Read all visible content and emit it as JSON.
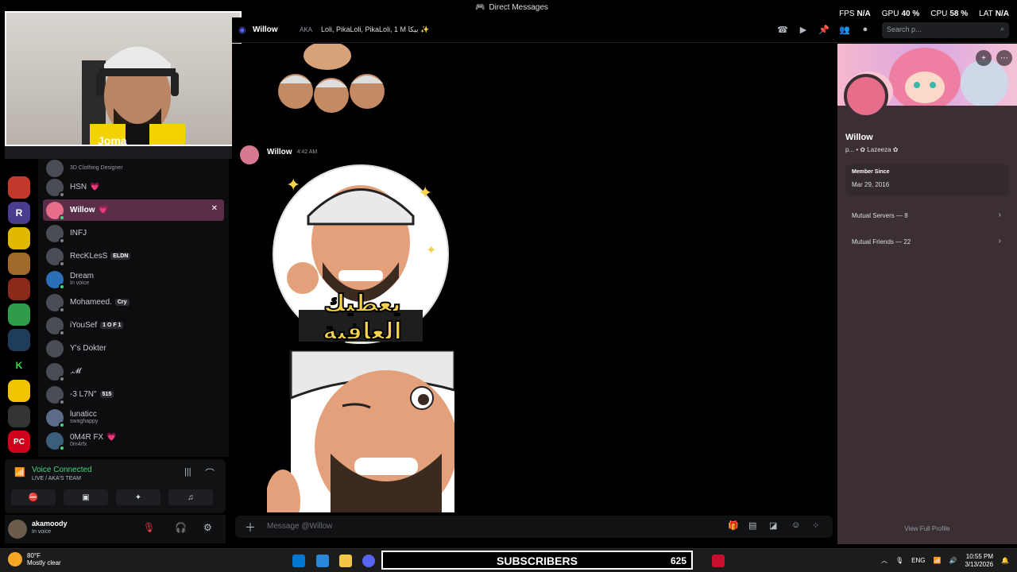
{
  "window": {
    "title": "Direct Messages"
  },
  "overlay": {
    "fps_label": "FPS",
    "fps": "N/A",
    "gpu_label": "GPU",
    "gpu": "40 %",
    "cpu_label": "CPU",
    "cpu": "58 %",
    "lat_label": "LAT",
    "lat": "N/A"
  },
  "webcam": {
    "shirt_text": "Joma"
  },
  "dm_list": [
    {
      "name": "HSN",
      "sub": "",
      "badge": "💗"
    },
    {
      "name": "Willow",
      "sub": "",
      "badge": "💗"
    },
    {
      "name": "INFJ",
      "sub": "",
      "badge": ""
    },
    {
      "name": "RecKLesS",
      "sub": "",
      "badge": "ELDN"
    },
    {
      "name": "Dream",
      "sub": "In voice",
      "badge": ""
    },
    {
      "name": "Mohameed.",
      "sub": "",
      "badge": "Cry"
    },
    {
      "name": "iYouSef",
      "sub": "",
      "badge": "1 O F 1"
    },
    {
      "name": "Y's Dokter",
      "sub": "",
      "badge": ""
    },
    {
      "name": ".𝓜",
      "sub": "",
      "badge": ""
    },
    {
      "name": "-3 L7N\"",
      "sub": "",
      "badge": "515"
    },
    {
      "name": "lunaticc",
      "sub": "swaghappy",
      "badge": ""
    },
    {
      "name": "0M4R FX",
      "sub": "0m4rfx",
      "badge": "💗"
    }
  ],
  "dm_top_partial": {
    "sub": "3D Clothing Designer"
  },
  "voice": {
    "status": "Voice Connected",
    "channel": "LIVE / AKA'S TEAM"
  },
  "user": {
    "name": "akamoody",
    "status": "In voice"
  },
  "chat": {
    "recipient": "Willow",
    "aka_label": "AKA",
    "aka_value": "Loli, PikaLoli, PikaLoli, 1 M بيكا ✨",
    "search_placeholder": "Search p...",
    "message_author": "Willow",
    "message_time": "4:42 AM",
    "sticker_text": "يعطيك العافية",
    "composer_placeholder": "Message @Willow"
  },
  "profile": {
    "name": "Willow",
    "tags": "p... • ✿ Lazeeza ✿",
    "member_since_label": "Member Since",
    "member_since": "Mar 29, 2016",
    "mutual_servers": "Mutual Servers — 8",
    "mutual_friends": "Mutual Friends — 22",
    "footer": "View Full Profile"
  },
  "taskbar": {
    "temp": "80°F",
    "condition": "Mostly clear",
    "subscribers_label": "SUBSCRIBERS",
    "subscribers_count": "625",
    "lang": "ENG",
    "time": "10:55 PM",
    "date": "3/13/2026"
  },
  "colors": {
    "accent_online": "#43d67b",
    "active_dm": "#5a2e47"
  }
}
